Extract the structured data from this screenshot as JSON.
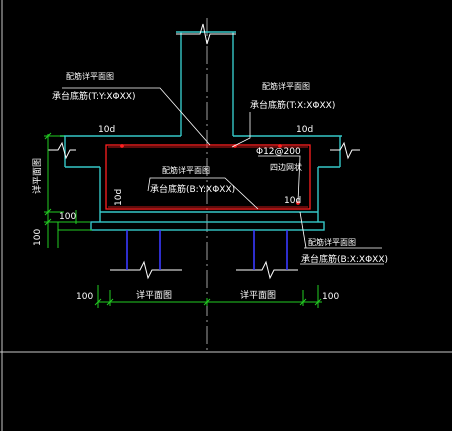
{
  "labels": {
    "tl_title": "配筋详平面图",
    "tl_sub": "承台底筋(T:Y:XΦXX)",
    "tr_title": "配筋详平面图",
    "tr_sub": "承台底筋(T:X:XΦXX)",
    "left_10d": "10d",
    "right_10d": "10d",
    "center_title": "配筋详平面图",
    "center_sub": "承台底筋(B:Y:XΦXX)",
    "stirrup": "Φ12@200",
    "stirrup_sub": "四边网状",
    "vert_10d": "10d",
    "corner_10d": "10d",
    "left_vertical": "详平面图",
    "dim_100a": "100",
    "dim_100b": "100",
    "br_title": "配筋详平面图",
    "br_sub": "承台底筋(B:X:XΦXX)",
    "bottom_left_100": "100",
    "bottom_left_label": "详平面图",
    "bottom_right_label": "详平面图",
    "bottom_right_100": "100"
  },
  "colors": {
    "background": "#000000",
    "structure": "#35c7c7",
    "pile": "#3a3aff",
    "rebar": "#ff2020",
    "dimension": "#22cc22",
    "leader": "#ffffff",
    "frame": "#c8c8c8"
  }
}
